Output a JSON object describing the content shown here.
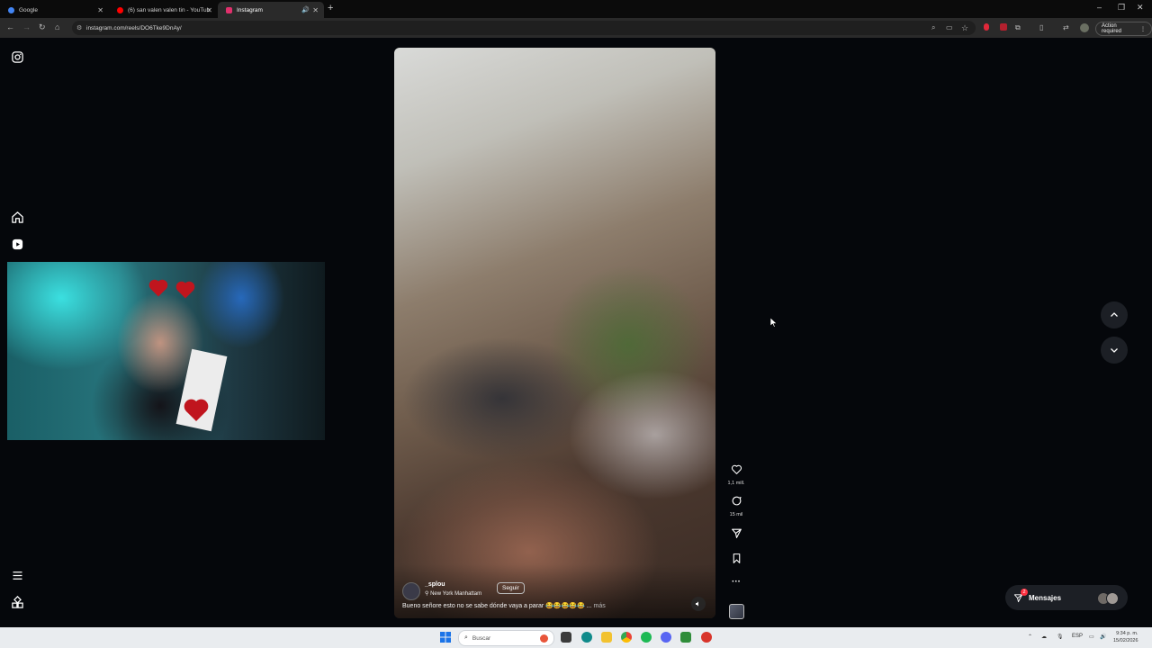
{
  "browser": {
    "tabs": [
      {
        "title": "Google",
        "favicon_color": "#4285f4"
      },
      {
        "title": "(6) san valen valen tin - YouTub",
        "favicon_color": "#ff0000"
      },
      {
        "title": "Instagram",
        "favicon_color": "#e1306c"
      }
    ],
    "url": "instagram.com/reels/DO6Tke9DnAy/",
    "action_required": "Action required"
  },
  "reel": {
    "username": "_splou",
    "location": "New York Manhattam",
    "follow_label": "Seguir",
    "caption": "Bueno señore esto no se sabe dónde vaya a parar 😂😂😂😂😂 ...",
    "caption_more": "más",
    "likes": "1,1 mill.",
    "comments": "15 mil"
  },
  "messages": {
    "label": "Mensajes",
    "badge": "2"
  },
  "taskbar": {
    "search_placeholder": "Buscar",
    "language": "ESP",
    "time": "9:34 p. m.",
    "date": "15/02/2026"
  },
  "colors": {
    "page_bg": "#05070b",
    "accent_red": "#ff3040"
  },
  "icons": [
    "instagram-logo-icon",
    "home-icon",
    "reels-icon",
    "menu-icon",
    "more-apps-icon",
    "heart-icon",
    "comment-icon",
    "share-icon",
    "bookmark-icon",
    "more-options-icon",
    "mute-icon",
    "chevron-up-icon",
    "chevron-down-icon",
    "send-icon"
  ]
}
